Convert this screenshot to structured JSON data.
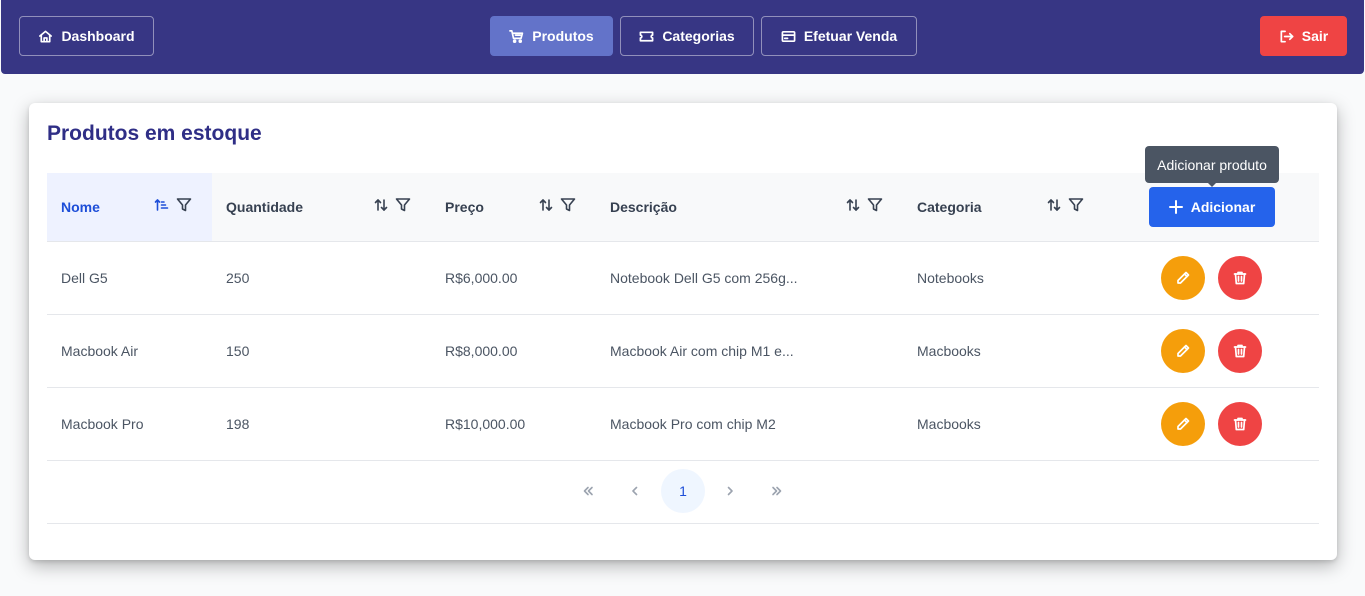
{
  "nav": {
    "dashboard": "Dashboard",
    "produtos": "Produtos",
    "categorias": "Categorias",
    "venda": "Efetuar Venda",
    "sair": "Sair",
    "active": "Produtos"
  },
  "page": {
    "title": "Produtos em estoque"
  },
  "table": {
    "columns": [
      "Nome",
      "Quantidade",
      "Preço",
      "Descrição",
      "Categoria"
    ],
    "sorted_column": "Nome",
    "add_label": "Adicionar",
    "tooltip": "Adicionar produto",
    "rows": [
      {
        "nome": "Dell G5",
        "quantidade": "250",
        "preco": "R$6,000.00",
        "descricao": "Notebook Dell G5 com 256g...",
        "categoria": "Notebooks"
      },
      {
        "nome": "Macbook Air",
        "quantidade": "150",
        "preco": "R$8,000.00",
        "descricao": "Macbook Air com chip M1 e...",
        "categoria": "Macbooks"
      },
      {
        "nome": "Macbook Pro",
        "quantidade": "198",
        "preco": "R$10,000.00",
        "descricao": "Macbook Pro com chip M2",
        "categoria": "Macbooks"
      }
    ]
  },
  "pagination": {
    "current_page": "1"
  },
  "icons": {
    "dashboard": "home-icon",
    "produtos": "cart-icon",
    "categorias": "ticket-icon",
    "venda": "credit-card-icon",
    "sair": "sign-out-icon",
    "add": "plus-icon",
    "edit": "pencil-icon",
    "delete": "trash-icon"
  },
  "colors": {
    "navbar": "#373684",
    "active_nav": "#6373c9",
    "danger": "#ef4444",
    "warning": "#f59e0b",
    "primary": "#2563eb",
    "title": "#2f2e86"
  }
}
